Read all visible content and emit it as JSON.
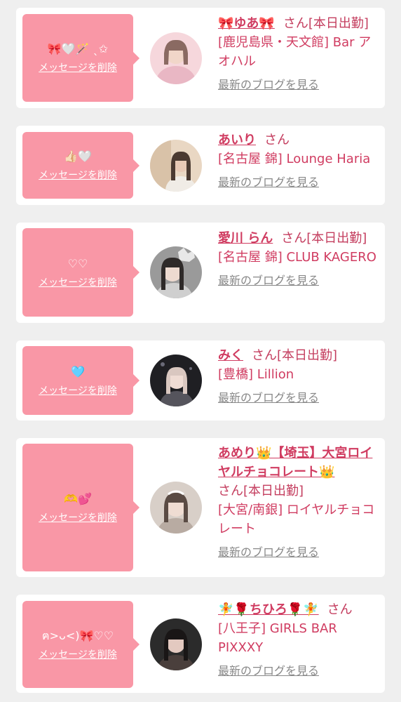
{
  "list": [
    {
      "emoji": "🎀🤍🪄 ˎ✩",
      "delete_label": "メッセージを削除",
      "name": "🎀ゆあ🎀",
      "honorific": "さん",
      "status": "[本日出勤]",
      "shop": "[鹿児島県・天文館] Bar アオハル",
      "blog_link": "最新のブログを見る"
    },
    {
      "emoji": "👍🏻🤍",
      "delete_label": "メッセージを削除",
      "name": "あいり",
      "honorific": "さん",
      "status": "",
      "shop": "[名古屋 錦] Lounge Haria",
      "blog_link": "最新のブログを見る"
    },
    {
      "emoji": "♡♡",
      "delete_label": "メッセージを削除",
      "name": "愛川 らん",
      "honorific": "さん",
      "status": "[本日出勤]",
      "shop": "[名古屋 錦] CLUB KAGERO",
      "blog_link": "最新のブログを見る"
    },
    {
      "emoji": "🩵",
      "delete_label": "メッセージを削除",
      "name": "みく",
      "honorific": "さん",
      "status": "[本日出勤]",
      "shop": "[豊橋] Lillion",
      "blog_link": "最新のブログを見る"
    },
    {
      "emoji": "🫶💕",
      "delete_label": "メッセージを削除",
      "name": "あめり👑【埼玉】大宮ロイヤルチョコレート👑",
      "honorific": "さん",
      "status": "[本日出勤]",
      "shop": "[大宮/南銀] ロイヤルチョコレート",
      "blog_link": "最新のブログを見る"
    },
    {
      "emoji": "ฅ>ᴗ<)🎀♡♡",
      "delete_label": "メッセージを削除",
      "name": "🧚🌹ちひろ🌹🧚",
      "honorific": "さん",
      "status": "",
      "shop": "[八王子] GIRLS BAR PIXXXY",
      "blog_link": "最新のブログを見る"
    }
  ],
  "avatar_colors": [
    [
      "#f6d7dc",
      "#e9b7c4",
      "#8a6a62"
    ],
    [
      "#e9d7c3",
      "#cfae8f",
      "#4b3a31"
    ],
    [
      "#cfcfcf",
      "#9a9a9a",
      "#2e2a29"
    ],
    [
      "#2a2a2e",
      "#55545c",
      "#d9c7c0"
    ],
    [
      "#d8cfc8",
      "#b8aba2",
      "#5a4b44"
    ],
    [
      "#2b2b2b",
      "#4a3f3c",
      "#e3c9c0"
    ]
  ]
}
